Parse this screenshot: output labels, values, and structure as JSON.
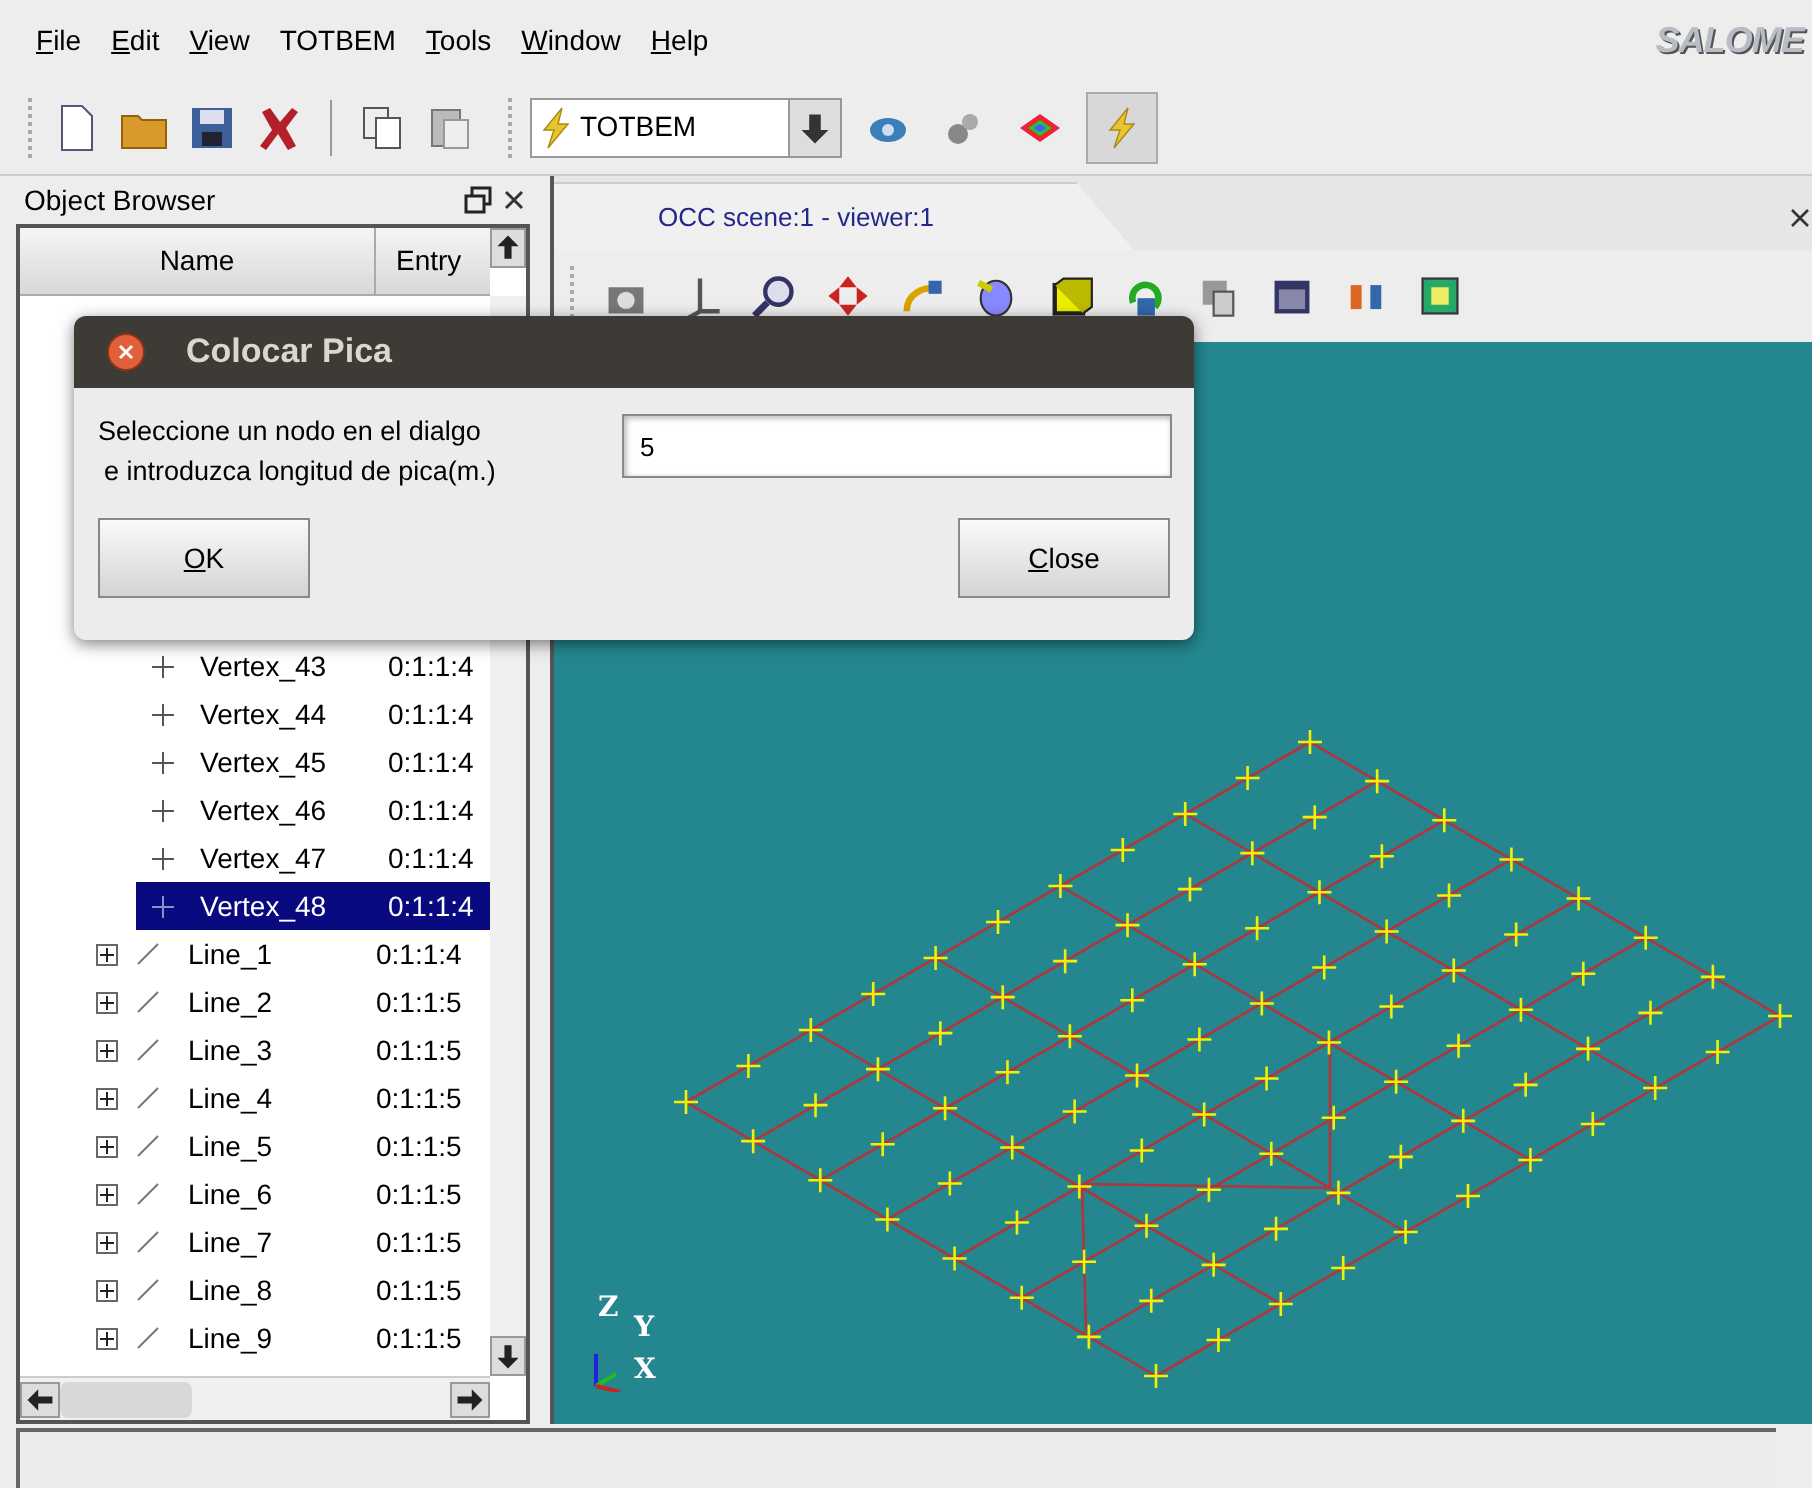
{
  "menu": [
    {
      "label": "File",
      "mnemonic": true
    },
    {
      "label": "Edit",
      "mnemonic": true
    },
    {
      "label": "View",
      "mnemonic": true
    },
    {
      "label": "TOTBEM",
      "mnemonic": false
    },
    {
      "label": "Tools",
      "mnemonic": true
    },
    {
      "label": "Window",
      "mnemonic": true
    },
    {
      "label": "Help",
      "mnemonic": true
    }
  ],
  "logo": "SALOME",
  "toolbar": {
    "module_select": {
      "value": "TOTBEM"
    },
    "tools": [
      {
        "kind": "new"
      },
      {
        "kind": "open"
      },
      {
        "kind": "save"
      },
      {
        "kind": "close"
      },
      {
        "kind": "sep"
      },
      {
        "kind": "copy"
      },
      {
        "kind": "paste"
      }
    ],
    "modules": [
      {
        "kind": "geometry",
        "selected": false
      },
      {
        "kind": "mesh",
        "selected": false
      },
      {
        "kind": "post",
        "selected": false
      },
      {
        "kind": "totbem",
        "selected": true
      }
    ]
  },
  "object_browser": {
    "title": "Object Browser",
    "columns": [
      "Name",
      "Entry"
    ],
    "rows": [
      {
        "kind": "vertex",
        "name": "Vertex_43",
        "entry": "0:1:1:4",
        "selected": false
      },
      {
        "kind": "vertex",
        "name": "Vertex_44",
        "entry": "0:1:1:4",
        "selected": false
      },
      {
        "kind": "vertex",
        "name": "Vertex_45",
        "entry": "0:1:1:4",
        "selected": false
      },
      {
        "kind": "vertex",
        "name": "Vertex_46",
        "entry": "0:1:1:4",
        "selected": false
      },
      {
        "kind": "vertex",
        "name": "Vertex_47",
        "entry": "0:1:1:4",
        "selected": false
      },
      {
        "kind": "vertex",
        "name": "Vertex_48",
        "entry": "0:1:1:4",
        "selected": true
      },
      {
        "kind": "line",
        "name": "Line_1",
        "entry": "0:1:1:4",
        "selected": false
      },
      {
        "kind": "line",
        "name": "Line_2",
        "entry": "0:1:1:5",
        "selected": false
      },
      {
        "kind": "line",
        "name": "Line_3",
        "entry": "0:1:1:5",
        "selected": false
      },
      {
        "kind": "line",
        "name": "Line_4",
        "entry": "0:1:1:5",
        "selected": false
      },
      {
        "kind": "line",
        "name": "Line_5",
        "entry": "0:1:1:5",
        "selected": false
      },
      {
        "kind": "line",
        "name": "Line_6",
        "entry": "0:1:1:5",
        "selected": false
      },
      {
        "kind": "line",
        "name": "Line_7",
        "entry": "0:1:1:5",
        "selected": false
      },
      {
        "kind": "line",
        "name": "Line_8",
        "entry": "0:1:1:5",
        "selected": false
      },
      {
        "kind": "line",
        "name": "Line_9",
        "entry": "0:1:1:5",
        "selected": false
      }
    ]
  },
  "viewer": {
    "tab": "OCC scene:1 - viewer:1",
    "axes": {
      "z": "Z",
      "y": "Y",
      "x": "X"
    }
  },
  "dialog": {
    "title": "Colocar Pica",
    "prompt": [
      "Seleccione un nodo en el dialgo",
      "e introduzca longitud de pica(m.)"
    ],
    "input": {
      "value": "5"
    },
    "buttons": [
      {
        "label": "OK",
        "mnemonic": true
      },
      {
        "label": "Close",
        "mnemonic": true
      }
    ]
  }
}
